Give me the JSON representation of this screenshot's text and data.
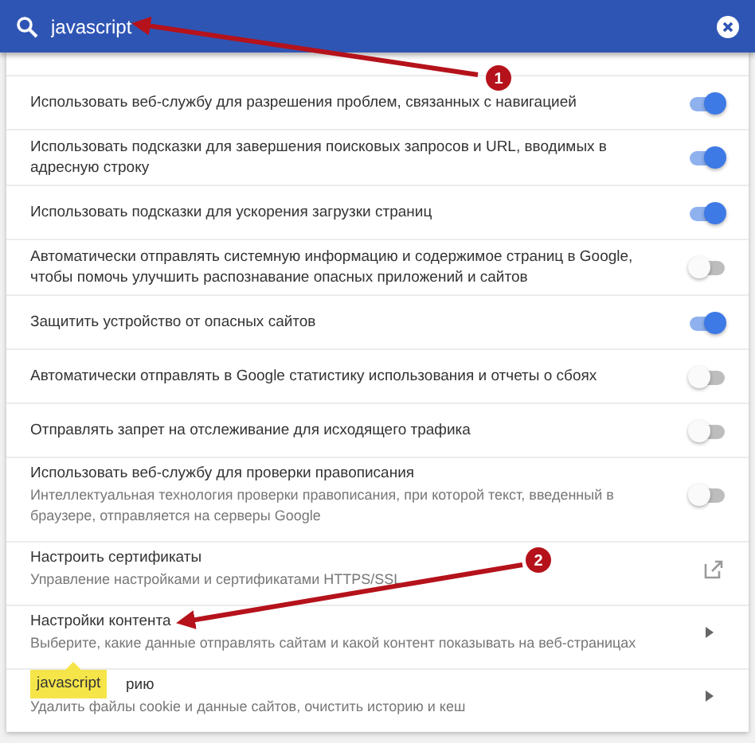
{
  "search": {
    "value": "javascript"
  },
  "settings": [
    {
      "kind": "toggle",
      "title": "Использовать веб-службу для разрешения проблем, связанных с навигацией",
      "on": true
    },
    {
      "kind": "toggle",
      "title": "Использовать подсказки для завершения поисковых запросов и URL, вводимых в адресную строку",
      "on": true
    },
    {
      "kind": "toggle",
      "title": "Использовать подсказки для ускорения загрузки страниц",
      "on": true
    },
    {
      "kind": "toggle",
      "title": "Автоматически отправлять системную информацию и содержимое страниц в Google, чтобы помочь улучшить распознавание опасных приложений и сайтов",
      "on": false
    },
    {
      "kind": "toggle",
      "title": "Защитить устройство от опасных сайтов",
      "on": true
    },
    {
      "kind": "toggle",
      "title": "Автоматически отправлять в Google статистику использования и отчеты о сбоях",
      "on": false
    },
    {
      "kind": "toggle",
      "title": "Отправлять запрет на отслеживание для исходящего трафика",
      "on": false
    },
    {
      "kind": "toggle",
      "title": "Использовать веб-службу для проверки правописания",
      "subtitle": "Интеллектуальная технология проверки правописания, при которой текст, введенный в браузере, отправляется на серверы Google",
      "on": false
    },
    {
      "kind": "external",
      "title": "Настроить сертификаты",
      "subtitle": "Управление настройками и сертификатами HTTPS/SSL"
    },
    {
      "kind": "submenu",
      "title": "Настройки контента",
      "subtitle": "Выберите, какие данные отправлять сайтам и какой контент показывать на веб-страницах"
    },
    {
      "kind": "submenu",
      "title": "рию",
      "subtitle": "Удалить файлы cookie и данные сайтов, очистить историю и кеш",
      "tooltip": "javascript"
    }
  ],
  "annotations": [
    {
      "number": "1"
    },
    {
      "number": "2"
    }
  ]
}
